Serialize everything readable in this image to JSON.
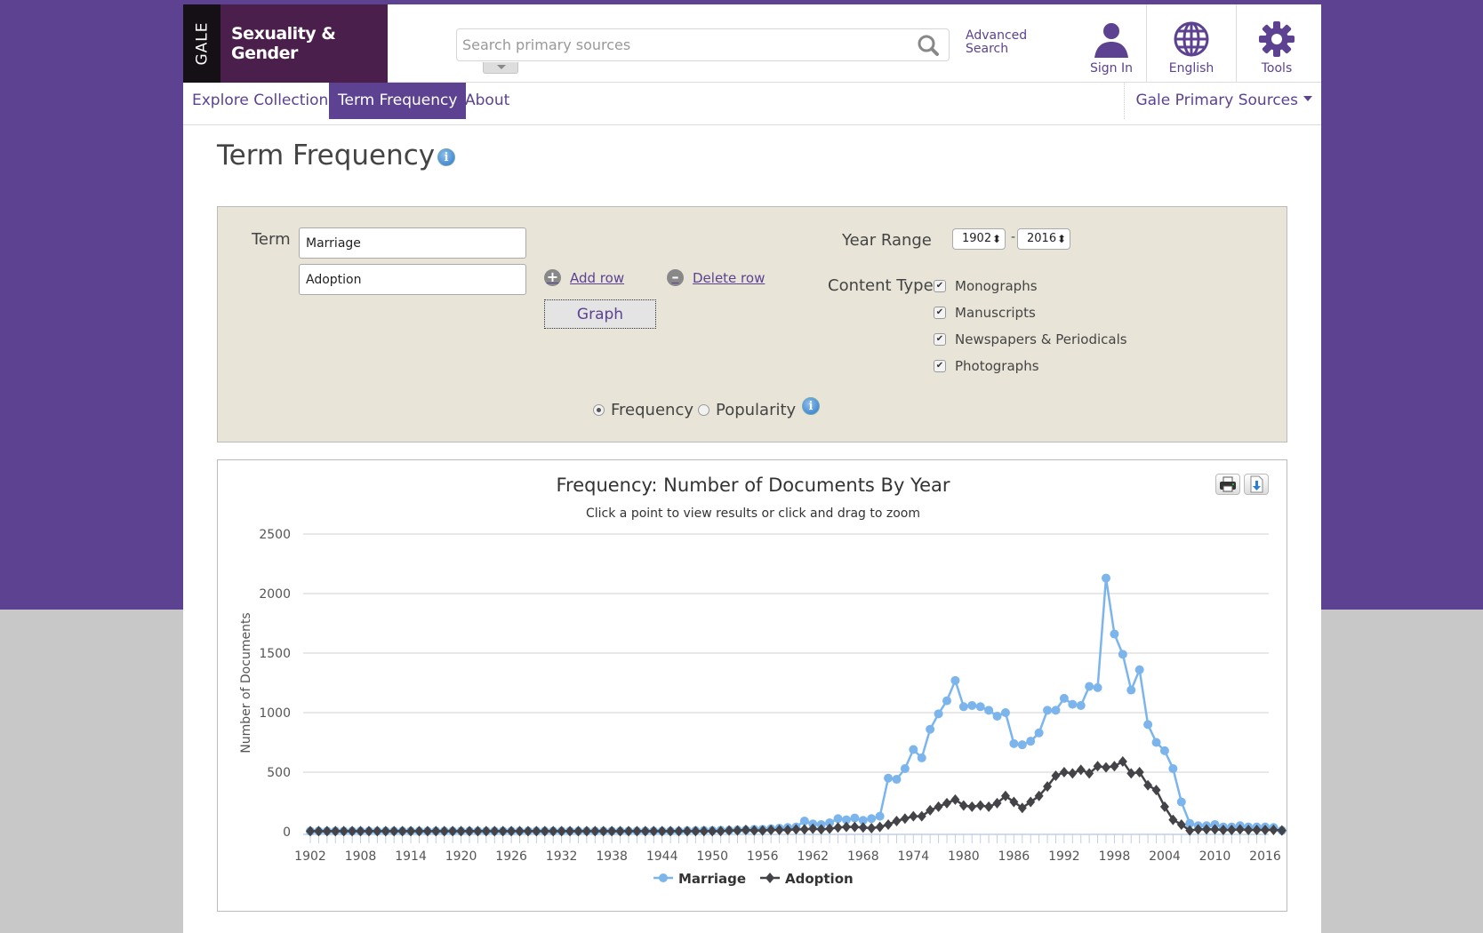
{
  "header": {
    "gale_logo": "GALE",
    "brand": "Sexuality & Gender",
    "search_placeholder": "Search primary sources",
    "advanced_search_line1": "Advanced",
    "advanced_search_line2": "Search",
    "sign_in": "Sign In",
    "language": "English",
    "tools": "Tools"
  },
  "nav": {
    "items": [
      {
        "label": "Explore Collections",
        "active": false
      },
      {
        "label": "Term Frequency",
        "active": true
      },
      {
        "label": "About",
        "active": false
      }
    ],
    "right_menu": "Gale Primary Sources"
  },
  "page": {
    "title": "Term Frequency"
  },
  "form": {
    "term_label": "Term",
    "terms": [
      "Marriage",
      "Adoption"
    ],
    "add_row": "Add row",
    "delete_row": "Delete row",
    "graph_button": "Graph",
    "year_range_label": "Year Range",
    "year_from": "1902",
    "year_to": "2016",
    "year_sep": "-",
    "content_type_label": "Content Type",
    "content_types": [
      {
        "label": "Monographs",
        "checked": true
      },
      {
        "label": "Manuscripts",
        "checked": true
      },
      {
        "label": "Newspapers & Periodicals",
        "checked": true
      },
      {
        "label": "Photographs",
        "checked": true
      }
    ],
    "mode_options": [
      {
        "label": "Frequency",
        "selected": true
      },
      {
        "label": "Popularity",
        "selected": false
      }
    ]
  },
  "colors": {
    "accent": "#5c4290",
    "marriage": "#7cb5ec",
    "adoption": "#434348"
  },
  "chart_data": {
    "type": "line",
    "title": "Frequency: Number of Documents By Year",
    "subtitle": "Click a point to view results or click and drag to zoom",
    "xlabel": "",
    "ylabel": "Number of Documents",
    "ylim": [
      0,
      2500
    ],
    "yticks": [
      0,
      500,
      1000,
      1500,
      2000,
      2500
    ],
    "xlim": [
      1902,
      2016
    ],
    "xtick_labels": [
      "1902",
      "1908",
      "1914",
      "1920",
      "1926",
      "1932",
      "1938",
      "1944",
      "1950",
      "1956",
      "1962",
      "1968",
      "1974",
      "1980",
      "1986",
      "1992",
      "1998",
      "2004",
      "2010",
      "2016"
    ],
    "grid": true,
    "legend": "bottom-center",
    "x_start": 1902,
    "series": [
      {
        "name": "Marriage",
        "marker": "circle",
        "color": "#7cb5ec",
        "values": [
          5,
          5,
          5,
          5,
          5,
          5,
          5,
          5,
          5,
          5,
          5,
          5,
          5,
          5,
          5,
          5,
          5,
          5,
          5,
          5,
          5,
          5,
          5,
          5,
          5,
          5,
          5,
          5,
          5,
          5,
          5,
          5,
          5,
          5,
          5,
          5,
          5,
          5,
          5,
          5,
          5,
          5,
          5,
          5,
          5,
          8,
          8,
          10,
          10,
          12,
          12,
          15,
          15,
          20,
          20,
          25,
          30,
          35,
          40,
          90,
          65,
          60,
          75,
          110,
          100,
          115,
          95,
          110,
          130,
          450,
          440,
          530,
          690,
          620,
          860,
          990,
          1100,
          1270,
          1050,
          1060,
          1050,
          1020,
          970,
          1000,
          740,
          730,
          760,
          830,
          1020,
          1020,
          1120,
          1070,
          1060,
          1220,
          1210,
          2130,
          1660,
          1490,
          1190,
          1360,
          900,
          750,
          680,
          530,
          250,
          70,
          50,
          50,
          60,
          40,
          40,
          50,
          40,
          40,
          40,
          35,
          10
        ]
      },
      {
        "name": "Adoption",
        "marker": "diamond",
        "color": "#434348",
        "values": [
          5,
          5,
          5,
          5,
          5,
          5,
          5,
          5,
          5,
          5,
          5,
          5,
          5,
          5,
          5,
          5,
          5,
          5,
          5,
          5,
          5,
          5,
          5,
          5,
          5,
          5,
          5,
          5,
          5,
          5,
          5,
          5,
          5,
          5,
          5,
          5,
          5,
          5,
          5,
          5,
          5,
          5,
          5,
          5,
          5,
          5,
          5,
          5,
          5,
          5,
          10,
          10,
          15,
          10,
          10,
          15,
          15,
          15,
          20,
          20,
          25,
          20,
          25,
          35,
          40,
          40,
          35,
          30,
          40,
          60,
          90,
          110,
          130,
          130,
          180,
          210,
          240,
          270,
          220,
          210,
          220,
          210,
          240,
          300,
          250,
          200,
          250,
          300,
          380,
          470,
          500,
          490,
          520,
          490,
          550,
          540,
          550,
          590,
          490,
          500,
          390,
          350,
          210,
          100,
          60,
          10,
          20,
          20,
          20,
          15,
          15,
          20,
          15,
          15,
          15,
          15,
          10
        ]
      }
    ]
  }
}
